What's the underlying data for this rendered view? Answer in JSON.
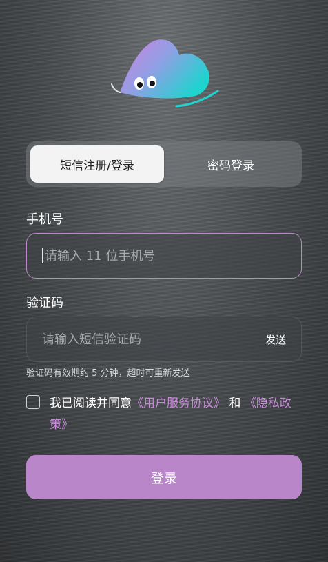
{
  "mascot": {
    "icon": "cloud-mascot-icon",
    "colors": [
      "#d27fe0",
      "#7ea8e0",
      "#1fd3cf"
    ]
  },
  "tabs": [
    {
      "label": "短信注册/登录",
      "active": true
    },
    {
      "label": "密码登录",
      "active": false
    }
  ],
  "phone": {
    "label": "手机号",
    "placeholder": "请输入 11 位手机号",
    "value": ""
  },
  "code": {
    "label": "验证码",
    "placeholder": "请输入短信验证码",
    "value": "",
    "send_label": "发送"
  },
  "hint": "验证码有效期约 5 分钟，超时可重新发送",
  "agreement": {
    "checked": false,
    "prefix": "我已阅读并同意",
    "terms_link": "《用户服务协议》",
    "and": " 和 ",
    "privacy_link": "《隐私政策》"
  },
  "login_button": "登录",
  "colors": {
    "accent": "#b987c9",
    "link": "#c78bd8",
    "active_input_border": "#b98bc6"
  }
}
